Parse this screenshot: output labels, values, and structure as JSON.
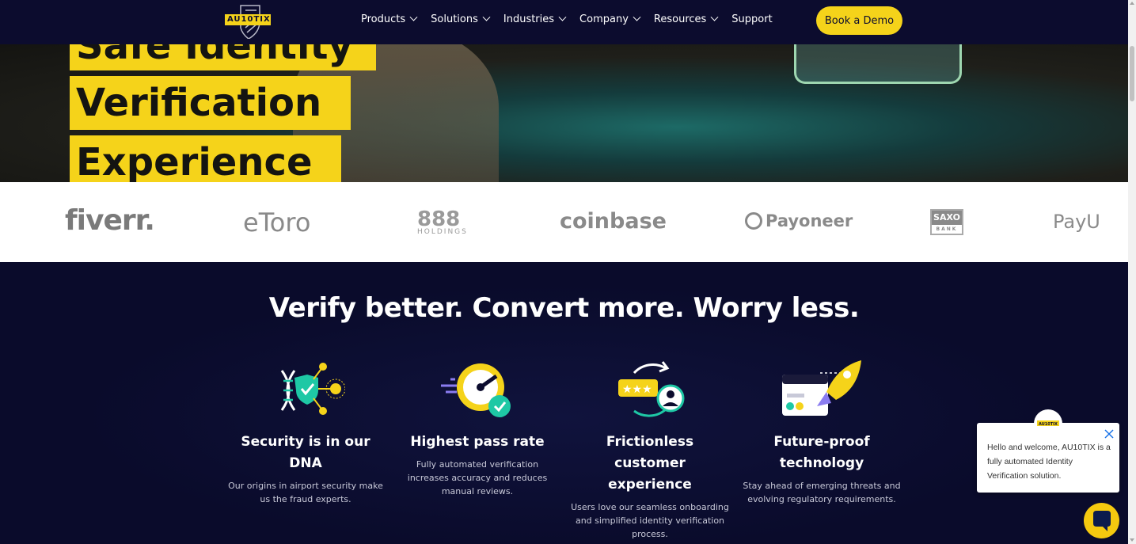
{
  "nav": {
    "logo_text": "AU10TIX",
    "menu": [
      {
        "label": "Products",
        "has_dropdown": true
      },
      {
        "label": "Solutions",
        "has_dropdown": true
      },
      {
        "label": "Industries",
        "has_dropdown": true
      },
      {
        "label": "Company",
        "has_dropdown": true
      },
      {
        "label": "Resources",
        "has_dropdown": true
      },
      {
        "label": "Support",
        "has_dropdown": false
      }
    ],
    "cta": "Book a Demo"
  },
  "hero": {
    "lines": [
      "Safe Identity",
      "Verification",
      "Experience"
    ]
  },
  "logos": {
    "fiverr": "fiverr.",
    "etoro": "eToro",
    "h888": "888",
    "h888_sub": "HOLDINGS",
    "coinbase": "coinbase",
    "payoneer": "Payoneer",
    "saxo": "SAXO",
    "saxo_sub": "BANK",
    "payu": "PayU"
  },
  "features": {
    "title": "Verify better. Convert more. Worry less.",
    "items": [
      {
        "title": "Security is in our DNA",
        "desc": "Our origins in airport security make us the fraud experts.",
        "icon": "dna-shield-icon"
      },
      {
        "title": "Highest pass rate",
        "desc": "Fully automated verification increases accuracy and reduces manual reviews.",
        "icon": "speedometer-check-icon"
      },
      {
        "title": "Frictionless customer experience",
        "desc": "Users love our seamless onboarding and simplified identity verification process.",
        "icon": "stars-user-cycle-icon"
      },
      {
        "title": "Future-proof technology",
        "desc": "Stay ahead of emerging threats and evolving regulatory requirements.",
        "icon": "rocket-browser-icon"
      }
    ]
  },
  "chat": {
    "avatar_text": "AU10TIX",
    "message": "Hello and welcome, AU10TIX is a fully automated Identity Verification solution."
  },
  "colors": {
    "brand_yellow": "#f5d31a",
    "navy": "#0c0c2e",
    "accent_teal": "#1ec8a5"
  }
}
